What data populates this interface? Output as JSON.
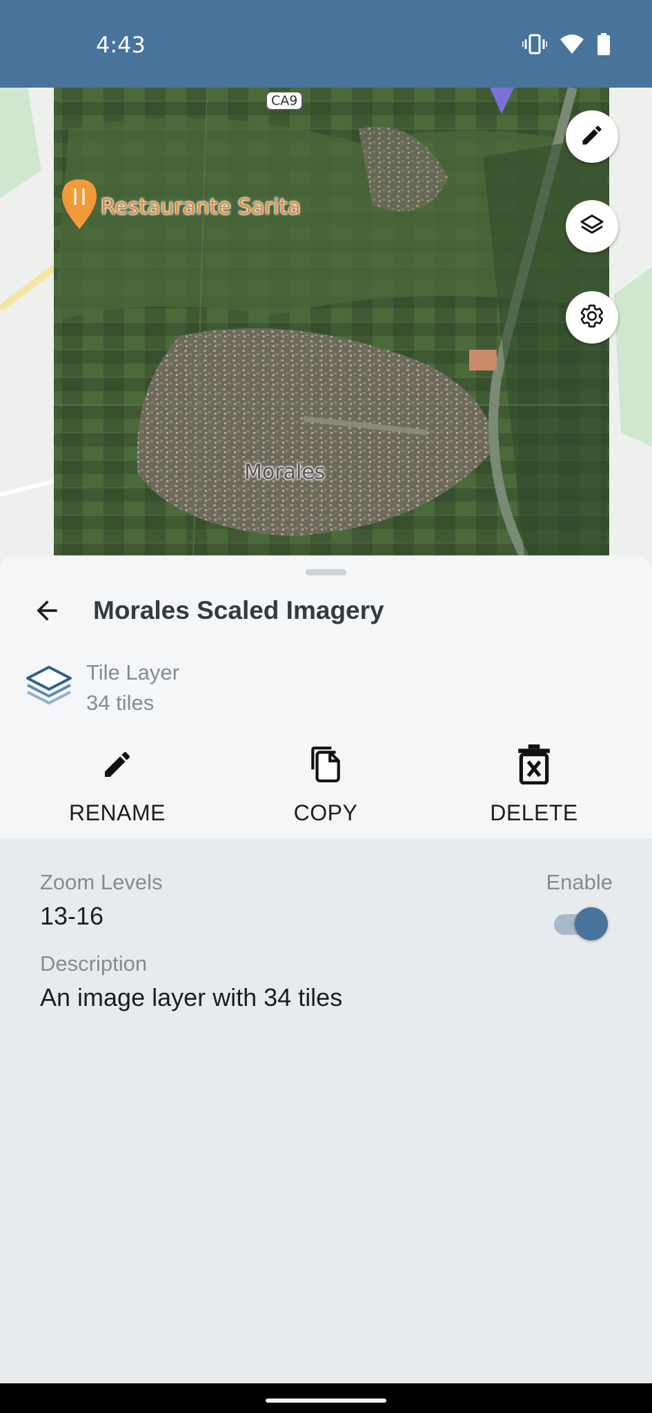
{
  "status_bar": {
    "time": "4:43",
    "icons": [
      "vibrate-icon",
      "wifi-icon",
      "battery-icon"
    ]
  },
  "map": {
    "road_badge": "CA9",
    "restaurant_label": "Restaurante Sarita",
    "town_label": "Morales",
    "buttons": [
      "edit-icon",
      "layers-icon",
      "settings-icon"
    ]
  },
  "sheet": {
    "title": "Morales Scaled Imagery",
    "layer_type": "Tile Layer",
    "layer_count": "34 tiles",
    "actions": {
      "rename": "RENAME",
      "copy": "COPY",
      "delete": "DELETE"
    }
  },
  "details": {
    "zoom_label": "Zoom Levels",
    "zoom_value": "13-16",
    "enable_label": "Enable",
    "enabled": true,
    "description_label": "Description",
    "description_value": "An image layer with 34 tiles"
  },
  "colors": {
    "primary": "#48739a",
    "sheet_bg": "#f5f6f8",
    "details_bg": "#e8ebee",
    "secondary_text": "#858b92"
  }
}
